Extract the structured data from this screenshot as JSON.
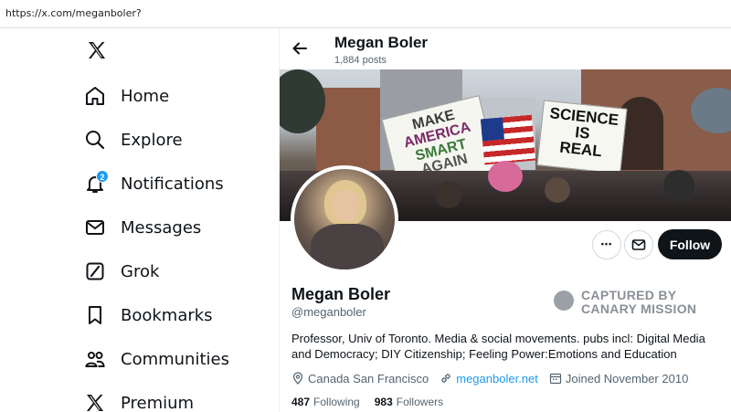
{
  "browser": {
    "url": "https://x.com/meganboler?"
  },
  "nav": {
    "logo": "x-logo-icon",
    "items": [
      {
        "label": "Home",
        "icon": "home-icon"
      },
      {
        "label": "Explore",
        "icon": "search-icon"
      },
      {
        "label": "Notifications",
        "icon": "bell-icon",
        "badge": "2"
      },
      {
        "label": "Messages",
        "icon": "envelope-icon"
      },
      {
        "label": "Grok",
        "icon": "grok-icon"
      },
      {
        "label": "Bookmarks",
        "icon": "bookmark-icon"
      },
      {
        "label": "Communities",
        "icon": "people-icon"
      },
      {
        "label": "Premium",
        "icon": "x-logo-icon"
      }
    ]
  },
  "header": {
    "name": "Megan Boler",
    "posts": "1,884 posts"
  },
  "banner": {
    "signs": [
      "MAKE",
      "AMERICA",
      "SMART",
      "AGAIN",
      "SCIENCE",
      "IS",
      "REAL"
    ]
  },
  "actions": {
    "more": "•••",
    "follow": "Follow"
  },
  "profile": {
    "name": "Megan Boler",
    "handle": "@meganboler",
    "bio": "Professor, Univ of Toronto. Media & social movements. pubs incl: Digital Media and Democracy; DIY Citizenship; Feeling Power:Emotions and Education",
    "location": "Canada San Francisco",
    "website": "meganboler.net",
    "joined": "Joined November 2010",
    "following_count": "487",
    "following_label": "Following",
    "followers_count": "983",
    "followers_label": "Followers"
  },
  "watermark": {
    "line1": "CAPTURED BY",
    "line2": "CANARY MISSION"
  },
  "colors": {
    "accent": "#1d9bf0",
    "text": "#0f1419",
    "muted": "#536471",
    "follow_bg": "#0f1419"
  }
}
